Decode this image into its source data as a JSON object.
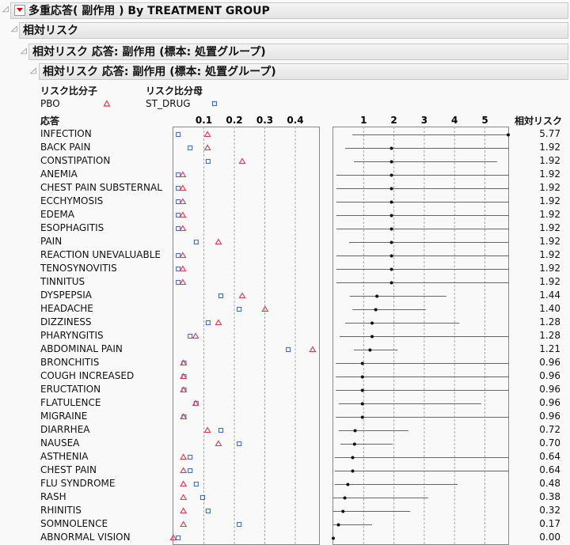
{
  "title": "多重応答( 副作用 ) By TREATMENT GROUP",
  "section": "相対リスク",
  "subsection": "相対リスク 応答: 副作用 (標本: 処置グループ)",
  "subsubsection": "相対リスク 応答: 副作用 (標本: 処置グループ)",
  "legend": {
    "numerator_label": "リスク比分子",
    "denominator_label": "リスク比分母",
    "numerator": "PBO",
    "denominator": "ST_DRUG"
  },
  "columns": {
    "response": "応答",
    "rr": "相対リスク"
  },
  "colors": {
    "numerator": "#e8334a",
    "denominator": "#3a6fe0"
  },
  "chart_data": [
    {
      "type": "scatter",
      "title": "proportions",
      "xlim": [
        0,
        0.48
      ],
      "ticks": [
        "0.1",
        "0.2",
        "0.3",
        "0.4"
      ],
      "tick_values": [
        0.1,
        0.2,
        0.3,
        0.4
      ],
      "series": [
        {
          "name": "PBO",
          "marker": "triangle"
        },
        {
          "name": "ST_DRUG",
          "marker": "square"
        }
      ]
    },
    {
      "type": "forest",
      "title": "相対リスク",
      "xlim": [
        0,
        5.8
      ],
      "ticks": [
        "1",
        "2",
        "3",
        "4",
        "5"
      ],
      "tick_values": [
        1,
        2,
        3,
        4,
        5
      ]
    }
  ],
  "rows": [
    {
      "label": "INFECTION",
      "pbo": 0.112,
      "st": 0.016,
      "rr": "5.77",
      "lo": 0.63,
      "hi": 5.8
    },
    {
      "label": "BACK PAIN",
      "pbo": 0.112,
      "st": 0.055,
      "rr": "1.92",
      "lo": 0.39,
      "hi": 5.8
    },
    {
      "label": "CONSTIPATION",
      "pbo": 0.226,
      "st": 0.114,
      "rr": "1.92",
      "lo": 0.68,
      "hi": 5.4
    },
    {
      "label": "ANEMIA",
      "pbo": 0.031,
      "st": 0.016,
      "rr": "1.92",
      "lo": 0.1,
      "hi": 5.8
    },
    {
      "label": "CHEST PAIN SUBSTERNAL",
      "pbo": 0.031,
      "st": 0.016,
      "rr": "1.92",
      "lo": 0.1,
      "hi": 5.8
    },
    {
      "label": "ECCHYMOSIS",
      "pbo": 0.031,
      "st": 0.016,
      "rr": "1.92",
      "lo": 0.1,
      "hi": 5.8
    },
    {
      "label": "EDEMA",
      "pbo": 0.031,
      "st": 0.016,
      "rr": "1.92",
      "lo": 0.1,
      "hi": 5.8
    },
    {
      "label": "ESOPHAGITIS",
      "pbo": 0.031,
      "st": 0.016,
      "rr": "1.92",
      "lo": 0.1,
      "hi": 5.8
    },
    {
      "label": "PAIN",
      "pbo": 0.148,
      "st": 0.075,
      "rr": "1.92",
      "lo": 0.52,
      "hi": 5.8
    },
    {
      "label": "REACTION UNEVALUABLE",
      "pbo": 0.031,
      "st": 0.016,
      "rr": "1.92",
      "lo": 0.1,
      "hi": 5.8
    },
    {
      "label": "TENOSYNOVITIS",
      "pbo": 0.031,
      "st": 0.016,
      "rr": "1.92",
      "lo": 0.1,
      "hi": 5.8
    },
    {
      "label": "TINNITUS",
      "pbo": 0.031,
      "st": 0.016,
      "rr": "1.92",
      "lo": 0.1,
      "hi": 5.8
    },
    {
      "label": "DYSPEPSIA",
      "pbo": 0.226,
      "st": 0.156,
      "rr": "1.44",
      "lo": 0.55,
      "hi": 3.73
    },
    {
      "label": "HEADACHE",
      "pbo": 0.301,
      "st": 0.216,
      "rr": "1.40",
      "lo": 0.63,
      "hi": 3.05
    },
    {
      "label": "DIZZINESS",
      "pbo": 0.148,
      "st": 0.114,
      "rr": "1.28",
      "lo": 0.39,
      "hi": 4.16
    },
    {
      "label": "PHARYNGITIS",
      "pbo": 0.073,
      "st": 0.055,
      "rr": "1.28",
      "lo": 0.21,
      "hi": 5.8
    },
    {
      "label": "ABDOMINAL PAIN",
      "pbo": 0.457,
      "st": 0.377,
      "rr": "1.21",
      "lo": 0.68,
      "hi": 2.12
    },
    {
      "label": "BRONCHITIS",
      "pbo": 0.033,
      "st": 0.035,
      "rr": "0.96",
      "lo": 0.08,
      "hi": 5.8
    },
    {
      "label": "COUGH INCREASED",
      "pbo": 0.033,
      "st": 0.035,
      "rr": "0.96",
      "lo": 0.08,
      "hi": 5.8
    },
    {
      "label": "ERUCTATION",
      "pbo": 0.033,
      "st": 0.035,
      "rr": "0.96",
      "lo": 0.08,
      "hi": 5.8
    },
    {
      "label": "FLATULENCE",
      "pbo": 0.073,
      "st": 0.075,
      "rr": "0.96",
      "lo": 0.18,
      "hi": 4.88
    },
    {
      "label": "MIGRAINE",
      "pbo": 0.033,
      "st": 0.035,
      "rr": "0.96",
      "lo": 0.08,
      "hi": 5.8
    },
    {
      "label": "DIARRHEA",
      "pbo": 0.112,
      "st": 0.156,
      "rr": "0.72",
      "lo": 0.18,
      "hi": 2.48
    },
    {
      "label": "NAUSEA",
      "pbo": 0.148,
      "st": 0.216,
      "rr": "0.70",
      "lo": 0.23,
      "hi": 1.96
    },
    {
      "label": "ASTHENIA",
      "pbo": 0.033,
      "st": 0.055,
      "rr": "0.64",
      "lo": 0.05,
      "hi": 5.8
    },
    {
      "label": "CHEST PAIN",
      "pbo": 0.033,
      "st": 0.055,
      "rr": "0.64",
      "lo": 0.05,
      "hi": 5.8
    },
    {
      "label": "FLU SYNDROME",
      "pbo": 0.033,
      "st": 0.075,
      "rr": "0.48",
      "lo": 0.05,
      "hi": 4.1
    },
    {
      "label": "RASH",
      "pbo": 0.033,
      "st": 0.096,
      "rr": "0.38",
      "lo": 0.0,
      "hi": 3.13
    },
    {
      "label": "RHINITIS",
      "pbo": 0.033,
      "st": 0.114,
      "rr": "0.32",
      "lo": 0.0,
      "hi": 2.53
    },
    {
      "label": "SOMNOLENCE",
      "pbo": 0.033,
      "st": 0.216,
      "rr": "0.17",
      "lo": 0.0,
      "hi": 1.28
    },
    {
      "label": "ABNORMAL VISION",
      "pbo": 0.0,
      "st": 0.016,
      "rr": "0.00",
      "lo": 0.0,
      "hi": 0.0
    }
  ]
}
